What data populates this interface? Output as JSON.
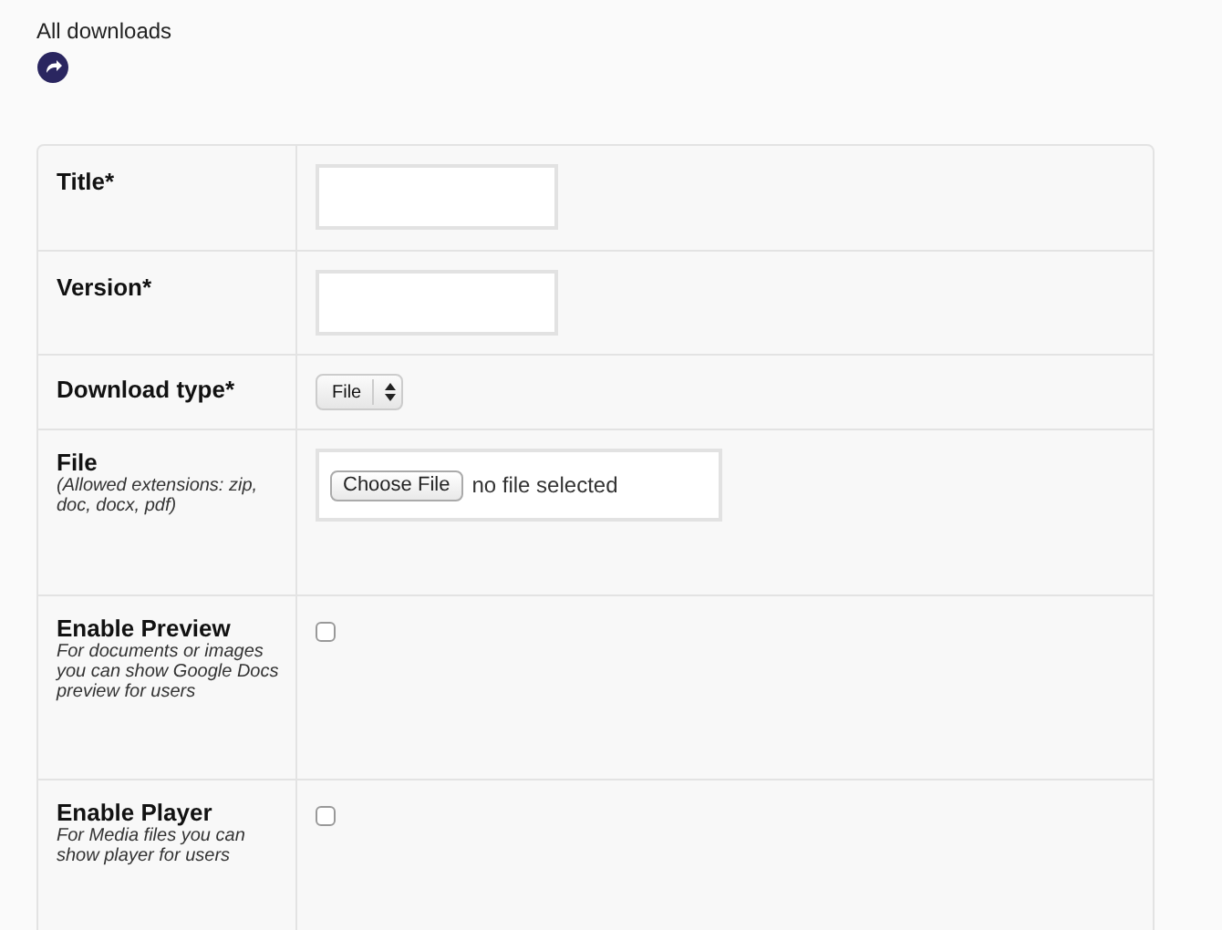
{
  "back_link": {
    "label": "All downloads"
  },
  "form_rows": [
    {
      "kind": "text",
      "label": "Title*",
      "value": ""
    },
    {
      "kind": "text",
      "label": "Version*",
      "value": ""
    },
    {
      "kind": "select",
      "label": "Download type*",
      "value": "File"
    },
    {
      "kind": "file",
      "label": "File",
      "hint": "(Allowed extensions: zip, doc, docx, pdf)",
      "button": "Choose File",
      "status": "no file selected"
    },
    {
      "kind": "checkbox",
      "label": "Enable Preview",
      "hint": "For documents or images you can show Google Docs preview for users",
      "checked": false
    },
    {
      "kind": "checkbox",
      "label": "Enable Player",
      "hint": "For Media files you can show player for users",
      "checked": false
    }
  ]
}
